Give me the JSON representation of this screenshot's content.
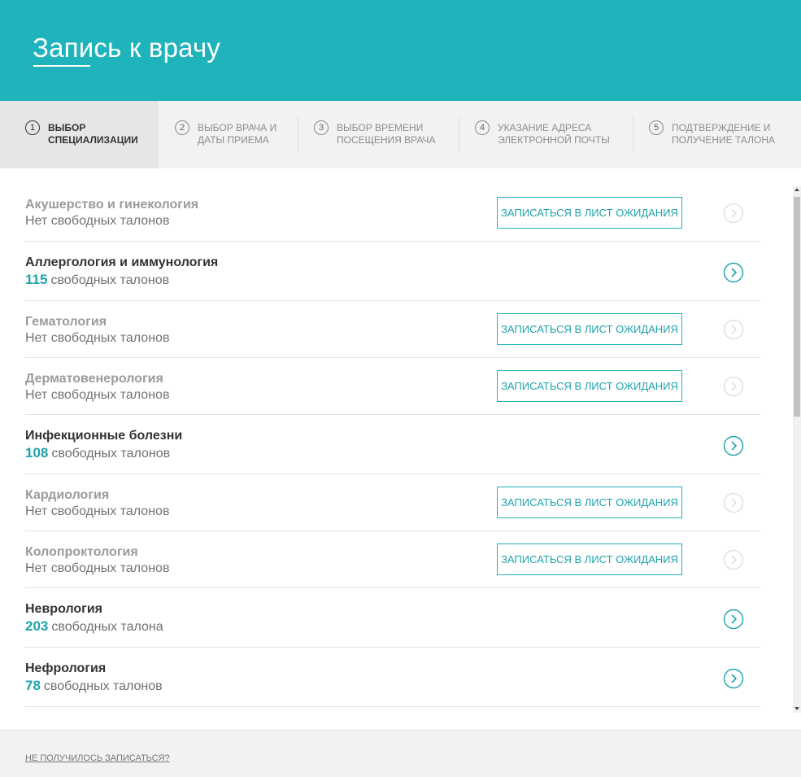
{
  "header": {
    "title": "Запись к врачу"
  },
  "steps": [
    {
      "num": "1",
      "label": "Выбор специализации"
    },
    {
      "num": "2",
      "label": "Выбор врача и даты приема"
    },
    {
      "num": "3",
      "label": "Выбор времени посещения врача"
    },
    {
      "num": "4",
      "label": "Указание адреса электронной почты"
    },
    {
      "num": "5",
      "label": "Подтверждение и получение талона"
    }
  ],
  "specialties": [
    {
      "name": "Акушерство и гинекология",
      "count": "",
      "slots_text": "Нет свободных талонов",
      "waitlist_label": "Записаться в лист ожидания"
    },
    {
      "name": "Аллергология и иммунология",
      "count": "115",
      "slots_text": "свободных талонов"
    },
    {
      "name": "Гематология",
      "count": "",
      "slots_text": "Нет свободных талонов",
      "waitlist_label": "Записаться в лист ожидания"
    },
    {
      "name": "Дерматовенерология",
      "count": "",
      "slots_text": "Нет свободных талонов",
      "waitlist_label": "Записаться в лист ожидания"
    },
    {
      "name": "Инфекционные болезни",
      "count": "108",
      "slots_text": "свободных талонов"
    },
    {
      "name": "Кардиология",
      "count": "",
      "slots_text": "Нет свободных талонов",
      "waitlist_label": "Записаться в лист ожидания"
    },
    {
      "name": "Колопроктология",
      "count": "",
      "slots_text": "Нет свободных талонов",
      "waitlist_label": "Записаться в лист ожидания"
    },
    {
      "name": "Неврология",
      "count": "203",
      "slots_text": "свободных талона"
    },
    {
      "name": "Нефрология",
      "count": "78",
      "slots_text": "свободных талонов"
    }
  ],
  "footer": {
    "help_link": "Не получилось записаться?"
  },
  "colors": {
    "accent": "#1fb3bb",
    "count": "#1fa3ab",
    "disabled_arrow": "#dddddd"
  }
}
